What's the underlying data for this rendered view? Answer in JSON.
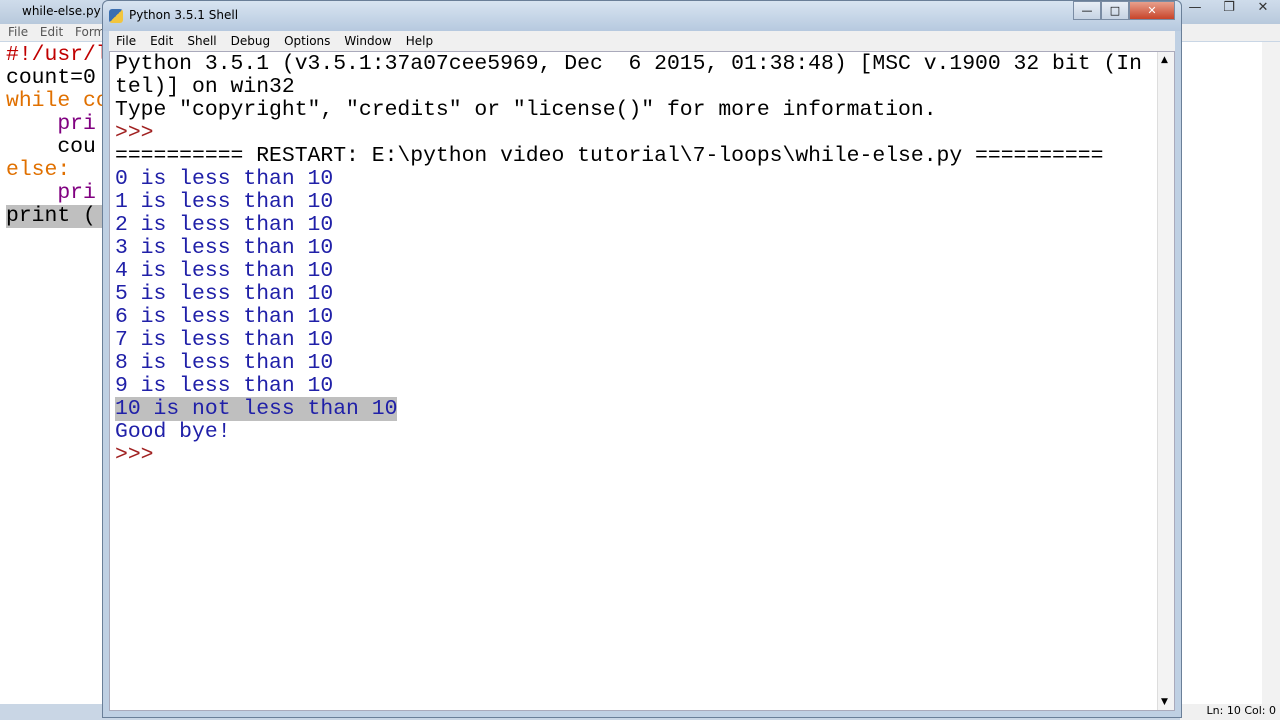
{
  "background_window": {
    "title": "while-else.py -",
    "menu": [
      "File",
      "Edit",
      "Form"
    ],
    "code": [
      "#!/usr/l",
      "",
      "count=0",
      "while co",
      "    pri",
      "    cou",
      "else:",
      "    pri",
      "",
      "print ("
    ],
    "status": "Ln: 10  Col: 0"
  },
  "shell": {
    "title": "Python 3.5.1 Shell",
    "menu": [
      "File",
      "Edit",
      "Shell",
      "Debug",
      "Options",
      "Window",
      "Help"
    ],
    "lines": [
      {
        "t": "Python 3.5.1 (v3.5.1:37a07cee5969, Dec  6 2015, 01:38:48) [MSC v.1900 32 bit (In",
        "c": ""
      },
      {
        "t": "tel)] on win32",
        "c": ""
      },
      {
        "t": "Type \"copyright\", \"credits\" or \"license()\" for more information.",
        "c": ""
      },
      {
        "t": ">>> ",
        "c": "prompt"
      },
      {
        "t": "========== RESTART: E:\\python video tutorial\\7-loops\\while-else.py ==========",
        "c": ""
      },
      {
        "t": "0 is less than 10",
        "c": "out"
      },
      {
        "t": "1 is less than 10",
        "c": "out"
      },
      {
        "t": "2 is less than 10",
        "c": "out"
      },
      {
        "t": "3 is less than 10",
        "c": "out"
      },
      {
        "t": "4 is less than 10",
        "c": "out"
      },
      {
        "t": "5 is less than 10",
        "c": "out"
      },
      {
        "t": "6 is less than 10",
        "c": "out"
      },
      {
        "t": "7 is less than 10",
        "c": "out"
      },
      {
        "t": "8 is less than 10",
        "c": "out"
      },
      {
        "t": "9 is less than 10",
        "c": "out"
      },
      {
        "t": "10 is not less than 10",
        "c": "out sel"
      },
      {
        "t": "Good bye!",
        "c": "out"
      },
      {
        "t": ">>> ",
        "c": "prompt"
      }
    ]
  }
}
